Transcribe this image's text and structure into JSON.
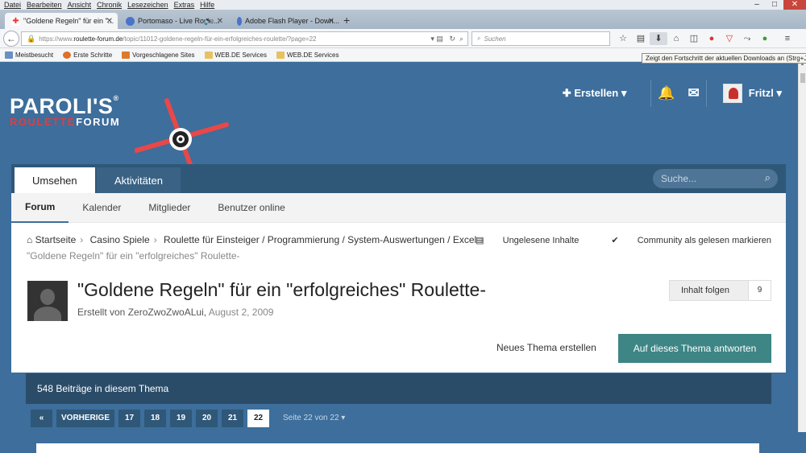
{
  "menubar": [
    "Datei",
    "Bearbeiten",
    "Ansicht",
    "Chronik",
    "Lesezeichen",
    "Extras",
    "Hilfe"
  ],
  "window_controls": {
    "minimize": "–",
    "maximize": "□",
    "close": "✕"
  },
  "tabs": [
    {
      "label": "\"Goldene Regeln\" für ein \"...",
      "active": true
    },
    {
      "label": "Portomaso - Live Roule...",
      "active": false
    },
    {
      "label": "Adobe Flash Player - Down...",
      "active": false
    }
  ],
  "new_tab": "+",
  "urlbar": {
    "prefix": "https://www.",
    "domain": "roulette-forum.de",
    "path": "/topic/11012-goldene-regeln-für-ein-erfolgreiches-roulette/?page=22"
  },
  "searchbar": {
    "placeholder": "Suchen"
  },
  "bookmarks": [
    "Meistbesucht",
    "Erste Schritte",
    "Vorgeschlagene Sites",
    "WEB.DE Services",
    "WEB.DE Services"
  ],
  "tooltip": "Zeigt den Fortschritt der aktuellen Downloads an (Strg+J)",
  "logo": {
    "main": "PAROLI'S",
    "reg": "®",
    "sub_red": "ROULETTE",
    "sub_white": "FORUM"
  },
  "header": {
    "create": "Erstellen",
    "username": "Fritzl"
  },
  "main_nav": {
    "tabs": [
      "Umsehen",
      "Aktivitäten"
    ],
    "search_placeholder": "Suche..."
  },
  "sub_nav": [
    "Forum",
    "Kalender",
    "Mitglieder",
    "Benutzer online"
  ],
  "breadcrumb": {
    "items": [
      "Startseite",
      "Casino Spiele",
      "Roulette für Einsteiger / Programmierung / System-Auswertungen / Excel"
    ],
    "current": "\"Goldene Regeln\" für ein \"erfolgreiches\" Roulette-"
  },
  "page_actions": {
    "unread": "Ungelesene Inhalte",
    "mark_read": "Community als gelesen markieren"
  },
  "thread": {
    "title": "\"Goldene Regeln\" für ein \"erfolgreiches\" Roulette-",
    "by_prefix": "Erstellt von ",
    "author": "ZeroZwoZwoALui",
    "date": "August 2, 2009",
    "follow_label": "Inhalt folgen",
    "follow_count": "9"
  },
  "buttons": {
    "new_topic": "Neues Thema erstellen",
    "reply": "Auf dieses Thema antworten"
  },
  "posts_count": "548 Beiträge in diesem Thema",
  "pagination": {
    "first": "«",
    "prev": "VORHERIGE",
    "pages": [
      "17",
      "18",
      "19",
      "20",
      "21",
      "22"
    ],
    "current": "22",
    "info": "Seite 22 von 22"
  }
}
